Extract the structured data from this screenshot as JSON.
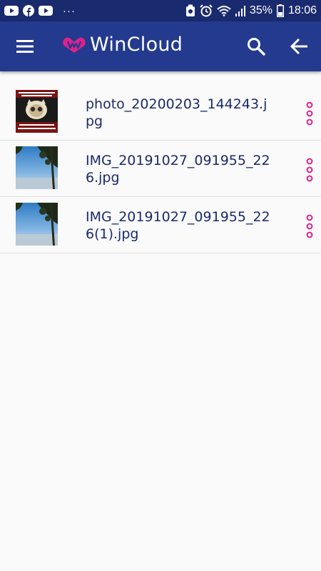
{
  "status_bar": {
    "icons": [
      "youtube-icon",
      "facebook-icon",
      "youtube-icon",
      "more-notifications-icon",
      "alarm-battery-icon",
      "alarm-clock-icon",
      "wifi-icon",
      "signal-icon",
      "battery-icon"
    ],
    "more": "···",
    "battery": "35%",
    "time": "18:06"
  },
  "app_bar": {
    "title": "WinCloud",
    "colors": {
      "background": "#233a8e",
      "logo": "#e0218a"
    }
  },
  "files": [
    {
      "name": "photo_20200203_144243.jpg",
      "thumb": "cat-meme-thumbnail"
    },
    {
      "name": "IMG_20191027_091955_226.jpg",
      "thumb": "sky-tree-thumbnail"
    },
    {
      "name": "IMG_20191027_091955_226(1).jpg",
      "thumb": "sky-tree-thumbnail"
    }
  ],
  "colors": {
    "accent": "#e0218a",
    "text": "#1b2a6a",
    "divider": "#dcdcdc"
  }
}
